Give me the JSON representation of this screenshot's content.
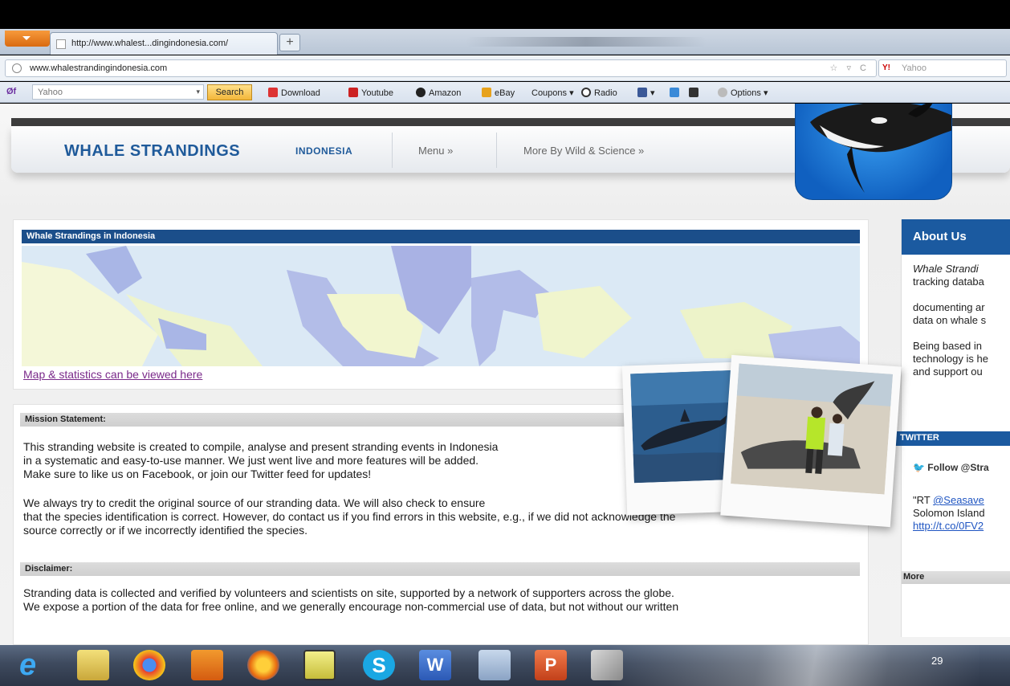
{
  "browser": {
    "tab_title": "http://www.whalest...dingindonesia.com/",
    "new_tab": "+",
    "url": "www.whalestrandingindonesia.com",
    "search_engine": "Yahoo"
  },
  "toolbar": {
    "logo": "Øf",
    "search_placeholder": "Yahoo",
    "search_button": "Search",
    "items": [
      "Download",
      "Youtube",
      "Amazon",
      "eBay",
      "Coupons",
      "Radio",
      "Options"
    ]
  },
  "header": {
    "title": "WHALE STRANDINGS",
    "subtitle": "INDONESIA",
    "menu": "Menu »",
    "more": "More By Wild & Science »"
  },
  "map_section": {
    "title": "Whale Strandings in Indonesia",
    "link": "Map & statistics can be viewed here"
  },
  "mission": {
    "heading": "Mission Statement:",
    "para1": [
      "This stranding website is created to compile, analyse and present stranding events in Indonesia",
      "in a systematic and easy-to-use manner. We just went live and more features will be added.",
      "Make sure to like us on Facebook, or join our Twitter feed for updates!"
    ],
    "para2": [
      "We always try to credit the original source of our stranding data. We will also check to ensure",
      "that the species identification is correct. However, do contact us if you find errors in this website, e.g., if we did not acknowledge the",
      "source correctly or if we incorrectly identified the species."
    ]
  },
  "disclaimer": {
    "heading": "Disclaimer:",
    "lines": [
      "Stranding data is collected and verified by volunteers and scientists on site, supported by a network of supporters across the globe.",
      "We expose a portion of the data for free online, and we generally encourage non-commercial use of data, but not without our written"
    ]
  },
  "sidebar": {
    "about_heading": "About Us",
    "about_lines": [
      "Whale Strandi",
      "tracking databa",
      "documenting ar",
      "data on whale s",
      "Being based in",
      "technology is he",
      "and support ou"
    ],
    "twitter_heading": "TWITTER",
    "follow": "Follow @Stra",
    "tweet_prefix": "\"RT ",
    "tweet_handle": "@Seasave",
    "tweet_line2": "Solomon Island",
    "tweet_link": "http://t.co/0FV2",
    "more_heading": "More"
  },
  "taskbar": {
    "clock": "29"
  },
  "colors": {
    "brand_blue": "#1f5a9a",
    "section_blue": "#1b4e8a",
    "link_purple": "#7a2a8a"
  }
}
